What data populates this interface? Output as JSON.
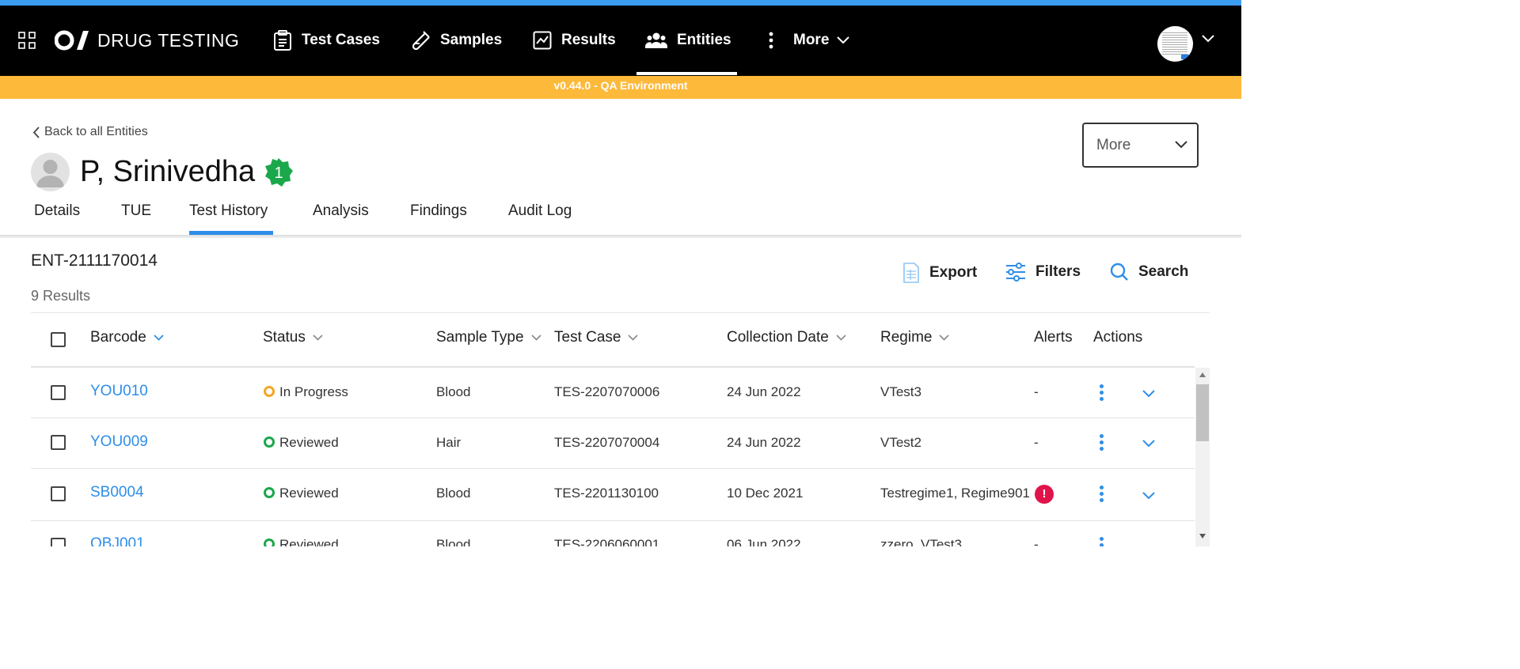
{
  "nav": {
    "brand": "DRUG TESTING",
    "items": [
      {
        "label": "Test Cases"
      },
      {
        "label": "Samples"
      },
      {
        "label": "Results"
      },
      {
        "label": "Entities"
      },
      {
        "label": "More"
      }
    ],
    "active": "Entities"
  },
  "env_banner": "v0.44.0 - QA Environment",
  "page": {
    "back_link": "Back to all Entities",
    "person_name": "P, Srinivedha",
    "badge_count": "1",
    "more_button": "More"
  },
  "tabs": [
    {
      "label": "Details"
    },
    {
      "label": "TUE"
    },
    {
      "label": "Test History"
    },
    {
      "label": "Analysis"
    },
    {
      "label": "Findings"
    },
    {
      "label": "Audit Log"
    }
  ],
  "active_tab": "Test History",
  "entity_id": "ENT-2111170014",
  "results_count": "9 Results",
  "toolbar": {
    "export": "Export",
    "filters": "Filters",
    "search": "Search"
  },
  "table": {
    "columns": {
      "barcode": "Barcode",
      "status": "Status",
      "sample_type": "Sample Type",
      "test_case": "Test Case",
      "collection_date": "Collection Date",
      "regime": "Regime",
      "alerts": "Alerts",
      "actions": "Actions"
    },
    "rows": [
      {
        "barcode": "YOU010",
        "status": "In Progress",
        "sample_type": "Blood",
        "test_case": "TES-2207070006",
        "collection_date": "24 Jun 2022",
        "regime": "VTest3",
        "alerts": "-"
      },
      {
        "barcode": "YOU009",
        "status": "Reviewed",
        "sample_type": "Hair",
        "test_case": "TES-2207070004",
        "collection_date": "24 Jun 2022",
        "regime": "VTest2",
        "alerts": "-"
      },
      {
        "barcode": "SB0004",
        "status": "Reviewed",
        "sample_type": "Blood",
        "test_case": "TES-2201130100",
        "collection_date": "10 Dec 2021",
        "regime": "Testregime1, Regime901",
        "alerts": "!"
      },
      {
        "barcode": "OBJ001",
        "status": "Reviewed",
        "sample_type": "Blood",
        "test_case": "TES-2206060001",
        "collection_date": "06 Jun 2022",
        "regime": "zzero, VTest3",
        "alerts": "-"
      }
    ]
  },
  "colors": {
    "accent": "#2e8ee8",
    "env_banner": "#fdb93a",
    "in_progress": "#f5a623",
    "reviewed": "#1aa84b",
    "alert": "#e0134b",
    "badge": "#1aa84b"
  }
}
